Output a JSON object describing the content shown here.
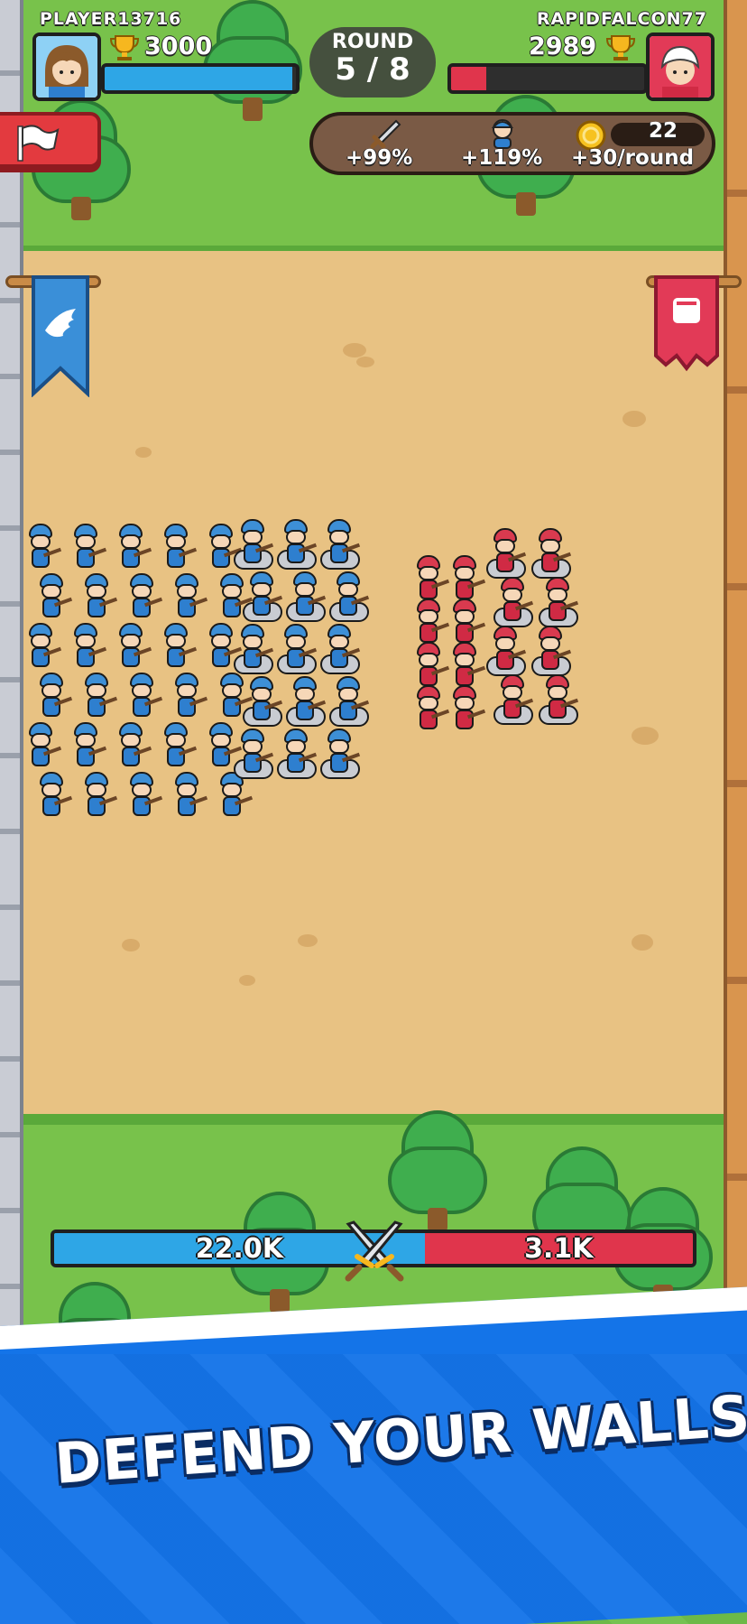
{
  "player": {
    "name": "PLAYER13716",
    "trophies": "3000",
    "health_fraction": 0.98,
    "color": "#2ea6e6"
  },
  "opponent": {
    "name": "RAPIDFALCON77",
    "trophies": "2989",
    "health_fraction": 0.18,
    "color": "#e0354c"
  },
  "round": {
    "label": "ROUND",
    "value": "5 / 8"
  },
  "stats": {
    "attack": "+99%",
    "units": "+119%",
    "coins": "22",
    "income": "+30/round"
  },
  "power": {
    "player": "22.0K",
    "opponent": "3.1K"
  },
  "promo": {
    "headline": "DEFEND YOUR WALLS"
  },
  "icons": {
    "flag": "surrender-flag-icon",
    "trophy": "trophy-icon",
    "sword": "sword-icon",
    "soldier": "soldier-icon",
    "coin": "coin-icon",
    "crossed_swords": "crossed-swords-icon"
  }
}
